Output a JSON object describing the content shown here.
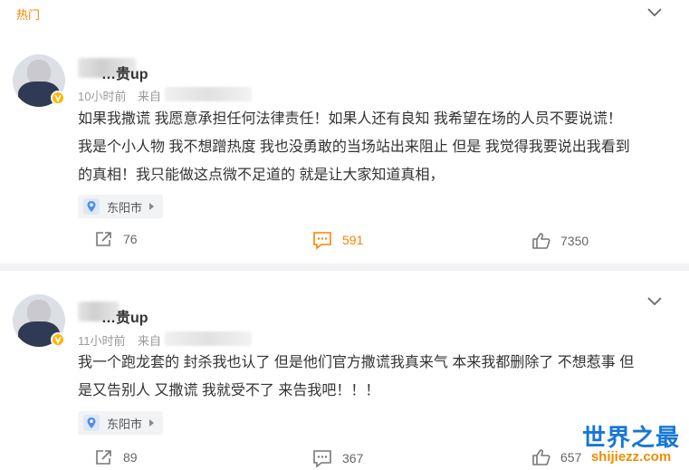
{
  "section": {
    "label": "热门"
  },
  "posts": [
    {
      "author": "…贵up",
      "time": "10小时前",
      "source_prefix": "来自",
      "text_lines": [
        "如果我撒谎 我愿意承担任何法律责任！如果人还有良知 我希望在场的人员不要说谎！",
        "我是个小人物 我不想蹭热度 我也没勇敢的当场站出来阻止 但是 我觉得我要说出我看到",
        "的真相！我只能做这点微不足道的 就是让大家知道真相，"
      ],
      "location": "东阳市",
      "shares": "76",
      "comments": "591",
      "likes": "7350"
    },
    {
      "author": "…贵up",
      "time": "11小时前",
      "source_prefix": "来自",
      "text_lines": [
        "我一个跑龙套的 封杀我也认了 但是他们官方撒谎我真来气 本来我都删除了 不想惹事 但",
        "是又告别人 又撒谎 我就受不了 来告我吧！！！"
      ],
      "location": "东阳市",
      "shares": "89",
      "comments": "367",
      "likes": "657"
    }
  ],
  "watermark": {
    "main": "世界之最",
    "sub": "shijiezz.com"
  },
  "colors": {
    "accent": "#ff8200",
    "badge": "#ffb400",
    "watermark_blue": "#1677d6",
    "watermark_orange": "#f08c00"
  }
}
